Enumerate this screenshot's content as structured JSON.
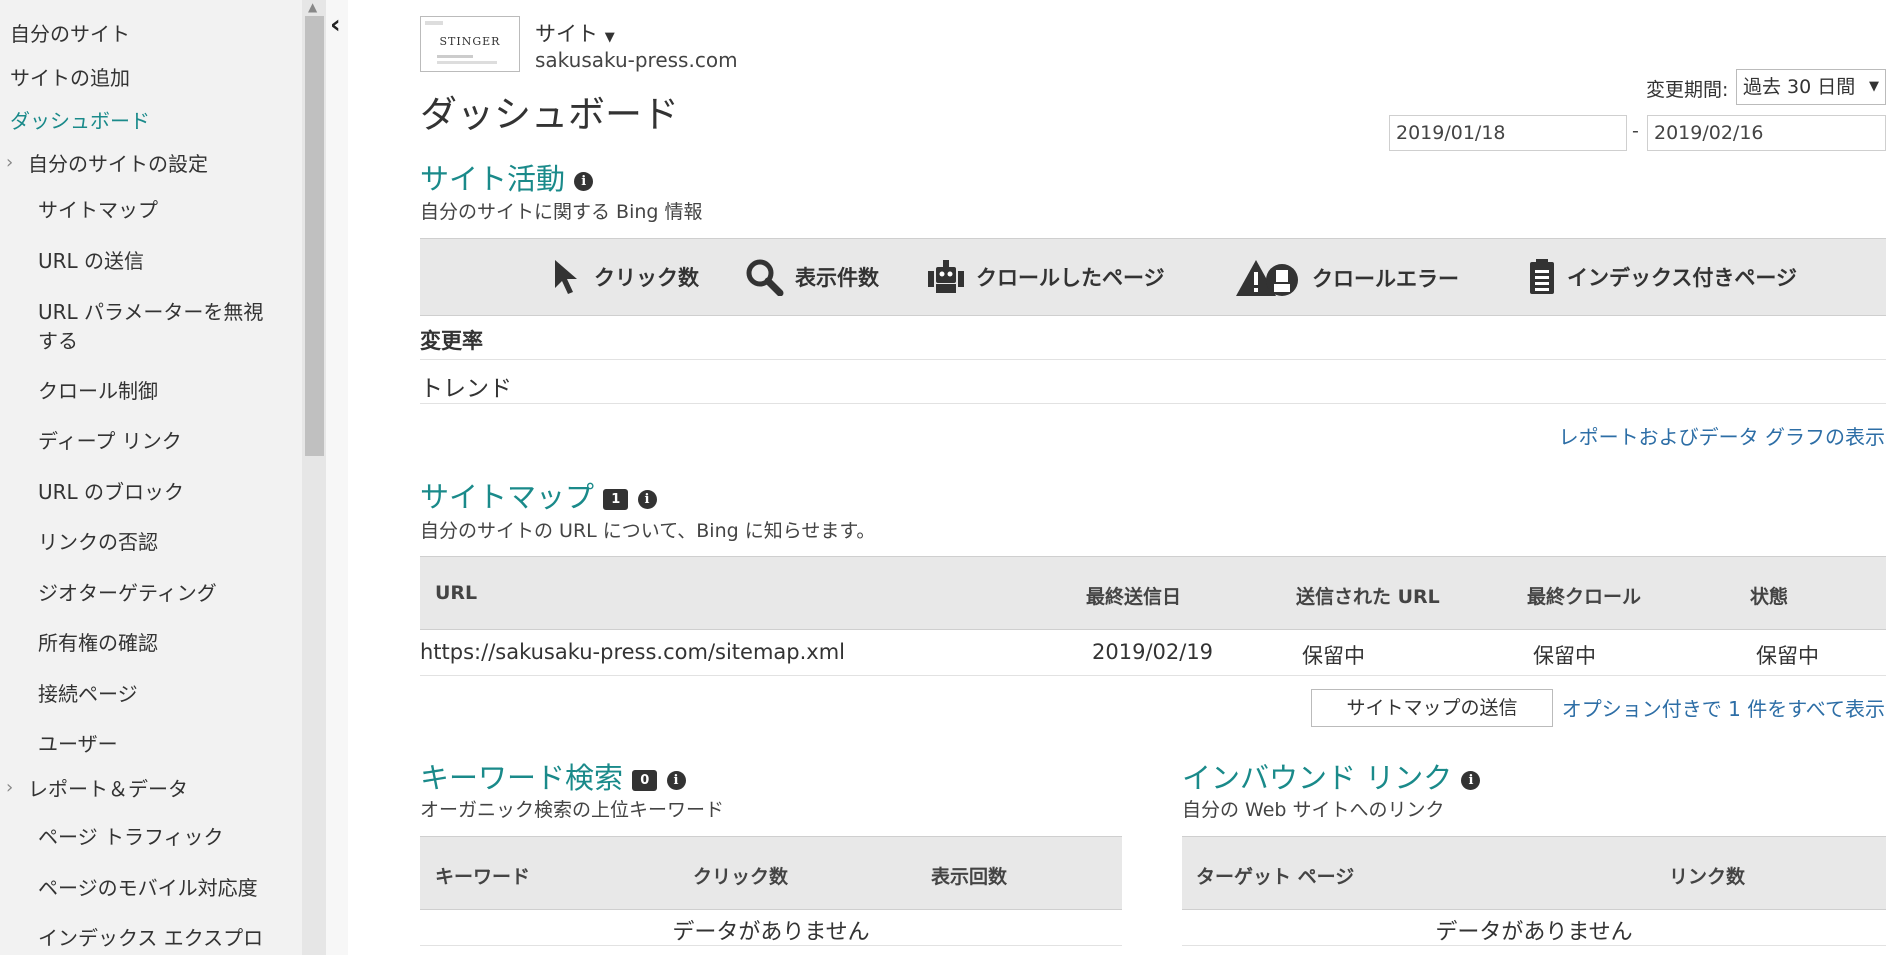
{
  "sidebar": {
    "top_items": [
      "自分のサイト",
      "サイトの追加",
      "ダッシュボード"
    ],
    "group_site_settings": "自分のサイトの設定",
    "site_settings_items": [
      "サイトマップ",
      "URL の送信",
      "URL パラメーターを無視",
      "する",
      "クロール制御",
      "ディープ リンク",
      "URL のブロック",
      "リンクの否認",
      "ジオターゲティング",
      "所有権の確認",
      "接続ページ",
      "ユーザー"
    ],
    "group_reports": "レポート＆データ",
    "report_items": [
      "ページ トラフィック",
      "ページのモバイル対応度",
      "インデックス エクスプロ"
    ]
  },
  "header": {
    "site_label": "サイト",
    "site_url": "sakusaku-press.com",
    "thumbnail_text": "STINGER",
    "page_title": "ダッシュボード",
    "period_label": "変更期間:",
    "period_value": "過去 30 日間",
    "date_from": "2019/01/18",
    "date_separator": "-",
    "date_to": "2019/02/16"
  },
  "site_activity": {
    "title": "サイト活動",
    "subtitle": "自分のサイトに関する Bing 情報",
    "metrics": [
      {
        "label": "クリック数",
        "icon": "cursor-icon"
      },
      {
        "label": "表示件数",
        "icon": "magnifier-icon"
      },
      {
        "label": "クロールしたページ",
        "icon": "robot-icon"
      },
      {
        "label": "クロールエラー",
        "icon": "warning-robot-icon"
      },
      {
        "label": "インデックス付きページ",
        "icon": "clipboard-icon"
      }
    ],
    "row_change": "変更率",
    "row_trend": "トレンド",
    "report_link": "レポートおよびデータ グラフの表示"
  },
  "sitemaps": {
    "title": "サイトマップ",
    "count": "1",
    "subtitle": "自分のサイトの URL について、Bing に知らせます。",
    "columns": [
      "URL",
      "最終送信日",
      "送信された URL",
      "最終クロール",
      "状態"
    ],
    "rows": [
      [
        "https://sakusaku-press.com/sitemap.xml",
        "2019/02/19",
        "保留中",
        "保留中",
        "保留中"
      ]
    ],
    "submit_button": "サイトマップの送信",
    "options_link": "オプション付きで 1 件をすべて表示"
  },
  "keywords": {
    "title": "キーワード検索",
    "count": "0",
    "subtitle": "オーガニック検索の上位キーワード",
    "columns": [
      "キーワード",
      "クリック数",
      "表示回数"
    ],
    "empty": "データがありません"
  },
  "inbound": {
    "title": "インバウンド リンク",
    "subtitle": "自分の Web サイトへのリンク",
    "columns": [
      "ターゲット ページ",
      "リンク数"
    ],
    "empty": "データがありません"
  },
  "colors": {
    "accent_teal": "#1a8a8a",
    "link_blue": "#2d6ea6",
    "sidebar_bg": "#f2f2f2"
  }
}
